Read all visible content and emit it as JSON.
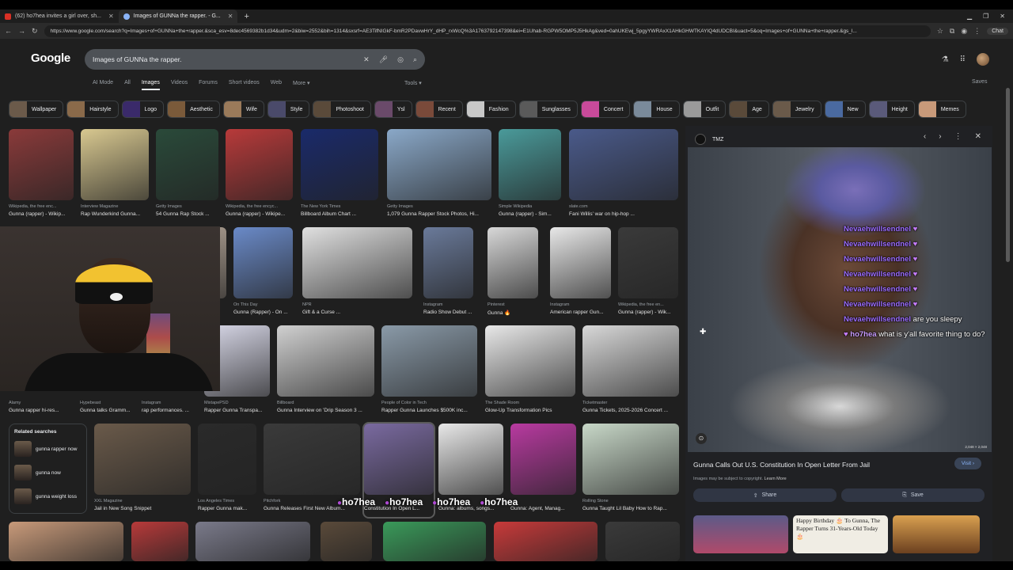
{
  "browser": {
    "tabs": [
      {
        "title": "(62) ho7hea invites a girl over, sh...",
        "active": false
      },
      {
        "title": "Images of GUNNa the rapper. - G...",
        "active": true
      }
    ],
    "url": "https://www.google.com/search?q=Images+of+GUNNa+the+rapper.&sca_esv=8dec4569382b1d34&udm=2&biw=2552&bih=1314&sxsrf=AE3TifNIGkF-bmR2PDavwHrY_dHP_rxWcQ%3A1763792147398&ei=E1Uhab-RGPW5OMP5J5HkAg&ved=0ahUKEwj_5pgyYWRAxX1AHkGHWTKAYIQ4dUDCBI&uact=5&oq=Images+of+GUNNa+the+rapper.&gs_l...",
    "chat_button": "Chat"
  },
  "google": {
    "logo": "Google",
    "query": "Images of GUNNa the rapper.",
    "nav": [
      "AI Mode",
      "All",
      "Images",
      "Videos",
      "Forums",
      "Short videos",
      "Web",
      "More ▾"
    ],
    "tools": "Tools ▾",
    "saves": "Saves",
    "chips": [
      {
        "label": "Wallpaper",
        "color": "#6b5a4a"
      },
      {
        "label": "Hairstyle",
        "color": "#8a6a4a"
      },
      {
        "label": "Logo",
        "color": "#3a2a6a"
      },
      {
        "label": "Aesthetic",
        "color": "#7a5a3a"
      },
      {
        "label": "Wife",
        "color": "#9a7a5a"
      },
      {
        "label": "Style",
        "color": "#4a4a6a"
      },
      {
        "label": "Photoshoot",
        "color": "#5a4a3a"
      },
      {
        "label": "Ysl",
        "color": "#6a4a6a"
      },
      {
        "label": "Recent",
        "color": "#7a4a3a"
      },
      {
        "label": "Fashion",
        "color": "#c8c8c8"
      },
      {
        "label": "Sunglasses",
        "color": "#5a5a5a"
      },
      {
        "label": "Concert",
        "color": "#c84a9a"
      },
      {
        "label": "House",
        "color": "#7a8a9a"
      },
      {
        "label": "Outfit",
        "color": "#9a9a9a"
      },
      {
        "label": "Age",
        "color": "#5a4a3a"
      },
      {
        "label": "Jewelry",
        "color": "#6a5a4a"
      },
      {
        "label": "New",
        "color": "#4a6aa0"
      },
      {
        "label": "Height",
        "color": "#5a5a7a"
      },
      {
        "label": "Memes",
        "color": "#c89a7a"
      }
    ],
    "grid": {
      "row1": [
        {
          "src": "Wikipedia, the free enc...",
          "cap": "Gunna (rapper) - Wikip...",
          "color": "#8a3a3a"
        },
        {
          "src": "Interview Magazine",
          "cap": "Rap Wunderkind Gunna...",
          "color": "#d8c890"
        },
        {
          "src": "Getty Images",
          "cap": "54 Gunna Rap Stock ...",
          "color": "#2a4a3a"
        },
        {
          "src": "Wikipedia, the free encyc...",
          "cap": "Gunna (rapper) - Wikipe...",
          "color": "#b83a3a"
        },
        {
          "src": "The New York Times",
          "cap": "Billboard Album Chart ...",
          "color": "#1a2a6a"
        },
        {
          "src": "Getty Images",
          "cap": "1,079 Gunna Rapper Stock Photos, Hi...",
          "color": "#8aa8c8"
        },
        {
          "src": "Simple Wikipedia",
          "cap": "Gunna (rapper) - Sim...",
          "color": "#4a9a9a"
        },
        {
          "src": "slate.com",
          "cap": "Fani Willis' war on hip-hop ...",
          "color": "#4a5a8a"
        }
      ],
      "row2": [
        {
          "src": "",
          "cap": "",
          "color": "#7a7aa0"
        },
        {
          "src": "",
          "cap": "",
          "color": "#c8b8a8"
        },
        {
          "src": "On This Day",
          "cap": "Gunna (Rapper) - On ...",
          "color": "#6a8ac8"
        },
        {
          "src": "NPR",
          "cap": "Gift & a Curse ...",
          "color": "#e0e0e0"
        },
        {
          "src": "Instagram",
          "cap": "Radio Show Debut ...",
          "color": "#6a7a9a"
        },
        {
          "src": "Pinterest",
          "cap": "Gunna 🔥",
          "color": "#d8d8d8"
        },
        {
          "src": "Instagram",
          "cap": "American rapper Gun...",
          "color": "#e8e8e8"
        },
        {
          "src": "Wikipedia, the free en...",
          "cap": "Gunna (rapper) - Wik...",
          "color": "#3a3a3a"
        }
      ],
      "row3": [
        {
          "src": "Alamy",
          "cap": "Gunna rapper hi-res...",
          "color": "#5a4a4a"
        },
        {
          "src": "Hypebeast",
          "cap": "Gunna talks Gramm...",
          "color": "#4a4a4a"
        },
        {
          "src": "Instagram",
          "cap": "rap performances. ...",
          "color": "#5a3a3a"
        },
        {
          "src": "MixtapePSD",
          "cap": "Rapper Gunna Transpa...",
          "color": "#d8d8e8"
        },
        {
          "src": "Billboard",
          "cap": "Gunna Interview on 'Drip Season 3 ...",
          "color": "#d0d0d0"
        },
        {
          "src": "People of Color in Tech",
          "cap": "Rapper Gunna Launches $500K inc...",
          "color": "#8a9aa8"
        },
        {
          "src": "The Shade Room",
          "cap": "Glow-Up Transformation Pics",
          "color": "#e8e8e8"
        },
        {
          "src": "Ticketmaster",
          "cap": "Gunna Tickets, 2025-2026 Concert ...",
          "color": "#d8d8d8"
        }
      ],
      "row4": [
        {
          "src": "XXL Magazine",
          "cap": "Jail in New Song Snippet",
          "color": "#6a5a4a"
        },
        {
          "src": "Los Angeles Times",
          "cap": "Rapper Gunna mak...",
          "color": "#2a2a2a"
        },
        {
          "src": "Pitchfork",
          "cap": "Gunna Releases First New Album...",
          "color": "#3a3a3a"
        },
        {
          "src": "",
          "cap": "Constitution In Open L...",
          "color": "#7a6aa0"
        },
        {
          "src": "",
          "cap": "Gunna: albums, songs...",
          "color": "#e8e8e8"
        },
        {
          "src": "",
          "cap": "Gunna: Agent, Manag...",
          "color": "#b83aa0"
        },
        {
          "src": "Rolling Stone",
          "cap": "Gunna Taught Lil Baby How to Rap...",
          "color": "#c8d8c8"
        }
      ]
    },
    "related": {
      "heading": "Related searches",
      "items": [
        "gunna rapper now",
        "gunna now",
        "gunna weight loss"
      ]
    },
    "panel": {
      "source": "TMZ",
      "title": "Gunna Calls Out U.S. Constitution In Open Letter From Jail",
      "visit": "Visit ›",
      "copyright": "Images may be subject to copyright.",
      "learn_more": "Learn More",
      "share": "Share",
      "save": "Save",
      "dims": "2,048 × 2,048",
      "more_text": "Happy Birthday 🎂 To Gunna, The Rapper Turns 31-Years-Old Today 🎂"
    }
  },
  "stream_chat": [
    {
      "user": "Nevaehwillsendnel",
      "msg": ""
    },
    {
      "user": "Nevaehwillsendnel",
      "msg": ""
    },
    {
      "user": "Nevaehwillsendnel",
      "msg": ""
    },
    {
      "user": "Nevaehwillsendnel",
      "msg": ""
    },
    {
      "user": "Nevaehwillsendnel",
      "msg": ""
    },
    {
      "user": "Nevaehwillsendnel",
      "msg": ""
    },
    {
      "user": "Nevaehwillsendnel",
      "msg": "are you sleepy"
    },
    {
      "user": "ho7hea",
      "msg": "what is y'all favorite thing to do?"
    }
  ],
  "overlay_names": [
    "ho7hea",
    "ho7hea",
    "ho7hea",
    "ho7hea"
  ]
}
